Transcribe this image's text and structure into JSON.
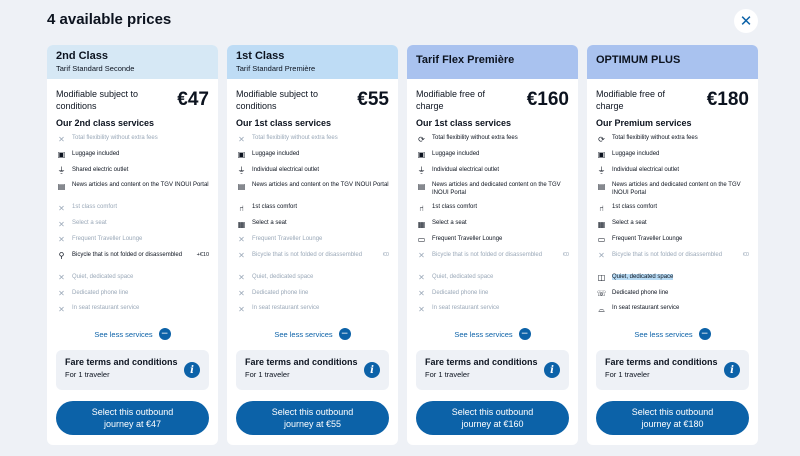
{
  "page": {
    "title": "4 available prices",
    "close_icon": "close-icon"
  },
  "colors": {
    "accent": "#0c62a8",
    "header_light": "#d6e8f5",
    "header_mid": "#bedcf5",
    "header_dark": "#a9c2ef",
    "muted": "#9aa8b8"
  },
  "cards": [
    {
      "name": "2nd Class",
      "subtitle": "Tarif Standard Seconde",
      "header_color": "#d6e8f5",
      "modifiable": "Modifiable subject to conditions",
      "price": "€47",
      "services_title": "Our 2nd class services",
      "services": [
        {
          "label": "Total flexibility without extra fees",
          "icon": "x-icon",
          "included": false
        },
        {
          "label": "Luggage included",
          "icon": "luggage-icon",
          "included": true
        },
        {
          "label": "Shared electric outlet",
          "icon": "plug-icon",
          "included": true
        },
        {
          "label": "News articles and content on the TGV INOUI Portal",
          "icon": "news-icon",
          "included": true
        },
        {
          "label": "1st class comfort",
          "icon": "x-icon",
          "included": false
        },
        {
          "label": "Select a seat",
          "icon": "x-icon",
          "included": false
        },
        {
          "label": "Frequent Traveller Lounge",
          "icon": "x-icon",
          "included": false
        },
        {
          "label": "Bicycle that is not folded or disassembled",
          "icon": "bicycle-icon",
          "included": true,
          "extra": "+€10"
        },
        {
          "label": "Quiet, dedicated space",
          "icon": "x-icon",
          "included": false
        },
        {
          "label": "Dedicated phone line",
          "icon": "x-icon",
          "included": false
        },
        {
          "label": "In seat restaurant service",
          "icon": "x-icon",
          "included": false
        }
      ],
      "see_less": "See less services",
      "fare_title": "Fare terms and conditions",
      "fare_sub": "For 1 traveler",
      "select": "Select this outbound journey at €47"
    },
    {
      "name": "1st Class",
      "subtitle": "Tarif Standard Première",
      "header_color": "#bedcf5",
      "modifiable": "Modifiable subject to conditions",
      "price": "€55",
      "services_title": "Our 1st class services",
      "services": [
        {
          "label": "Total flexibility without extra fees",
          "icon": "x-icon",
          "included": false
        },
        {
          "label": "Luggage included",
          "icon": "luggage-icon",
          "included": true
        },
        {
          "label": "Individual electrical outlet",
          "icon": "plug-icon",
          "included": true
        },
        {
          "label": "News articles and content on the TGV INOUI Portal",
          "icon": "news-icon",
          "included": true
        },
        {
          "label": "1st class comfort",
          "icon": "seat-icon",
          "included": true
        },
        {
          "label": "Select a seat",
          "icon": "seat-select-icon",
          "included": true
        },
        {
          "label": "Frequent Traveller Lounge",
          "icon": "x-icon",
          "included": false
        },
        {
          "label": "Bicycle that is not folded or disassembled",
          "icon": "x-icon",
          "included": false,
          "extra": "€0"
        },
        {
          "label": "Quiet, dedicated space",
          "icon": "x-icon",
          "included": false
        },
        {
          "label": "Dedicated phone line",
          "icon": "x-icon",
          "included": false
        },
        {
          "label": "In seat restaurant service",
          "icon": "x-icon",
          "included": false
        }
      ],
      "see_less": "See less services",
      "fare_title": "Fare terms and conditions",
      "fare_sub": "For 1 traveler",
      "select": "Select this outbound journey at €55"
    },
    {
      "name": "Tarif Flex Première",
      "subtitle": "",
      "header_color": "#a9c2ef",
      "modifiable": "Modifiable free of charge",
      "price": "€160",
      "services_title": "Our 1st class services",
      "services": [
        {
          "label": "Total flexibility without extra fees",
          "icon": "refresh-icon",
          "included": true
        },
        {
          "label": "Luggage included",
          "icon": "luggage-icon",
          "included": true
        },
        {
          "label": "Individual electrical outlet",
          "icon": "plug-icon",
          "included": true
        },
        {
          "label": "News articles and dedicated content on the TGV INOUI Portal",
          "icon": "news-icon",
          "included": true
        },
        {
          "label": "1st class comfort",
          "icon": "seat-icon",
          "included": true
        },
        {
          "label": "Select a seat",
          "icon": "seat-select-icon",
          "included": true
        },
        {
          "label": "Frequent Traveller Lounge",
          "icon": "lounge-icon",
          "included": true
        },
        {
          "label": "Bicycle that is not folded or disassembled",
          "icon": "x-icon",
          "included": false,
          "extra": "€0"
        },
        {
          "label": "Quiet, dedicated space",
          "icon": "x-icon",
          "included": false
        },
        {
          "label": "Dedicated phone line",
          "icon": "x-icon",
          "included": false
        },
        {
          "label": "In seat restaurant service",
          "icon": "x-icon",
          "included": false
        }
      ],
      "see_less": "See less services",
      "fare_title": "Fare terms and conditions",
      "fare_sub": "For 1 traveler",
      "select": "Select this outbound journey at €160"
    },
    {
      "name": "OPTIMUM PLUS",
      "subtitle": "",
      "header_color": "#a9c2ef",
      "modifiable": "Modifiable free of charge",
      "price": "€180",
      "services_title": "Our Premium services",
      "services": [
        {
          "label": "Total flexibility without extra fees",
          "icon": "refresh-icon",
          "included": true
        },
        {
          "label": "Luggage included",
          "icon": "luggage-icon",
          "included": true
        },
        {
          "label": "Individual electrical outlet",
          "icon": "plug-icon",
          "included": true
        },
        {
          "label": "News articles and dedicated content on the TGV INOUI Portal",
          "icon": "news-icon",
          "included": true
        },
        {
          "label": "1st class comfort",
          "icon": "seat-icon",
          "included": true
        },
        {
          "label": "Select a seat",
          "icon": "seat-select-icon",
          "included": true
        },
        {
          "label": "Frequent Traveller Lounge",
          "icon": "lounge-icon",
          "included": true
        },
        {
          "label": "Bicycle that is not folded or disassembled",
          "icon": "x-icon",
          "included": false,
          "extra": "€0"
        },
        {
          "label": "Quiet, dedicated space",
          "icon": "quiet-icon",
          "included": true,
          "highlighted": true
        },
        {
          "label": "Dedicated phone line",
          "icon": "phone-icon",
          "included": true
        },
        {
          "label": "In seat restaurant service",
          "icon": "restaurant-icon",
          "included": true
        }
      ],
      "see_less": "See less services",
      "fare_title": "Fare terms and conditions",
      "fare_sub": "For 1 traveler",
      "select": "Select this outbound journey at €180"
    }
  ]
}
